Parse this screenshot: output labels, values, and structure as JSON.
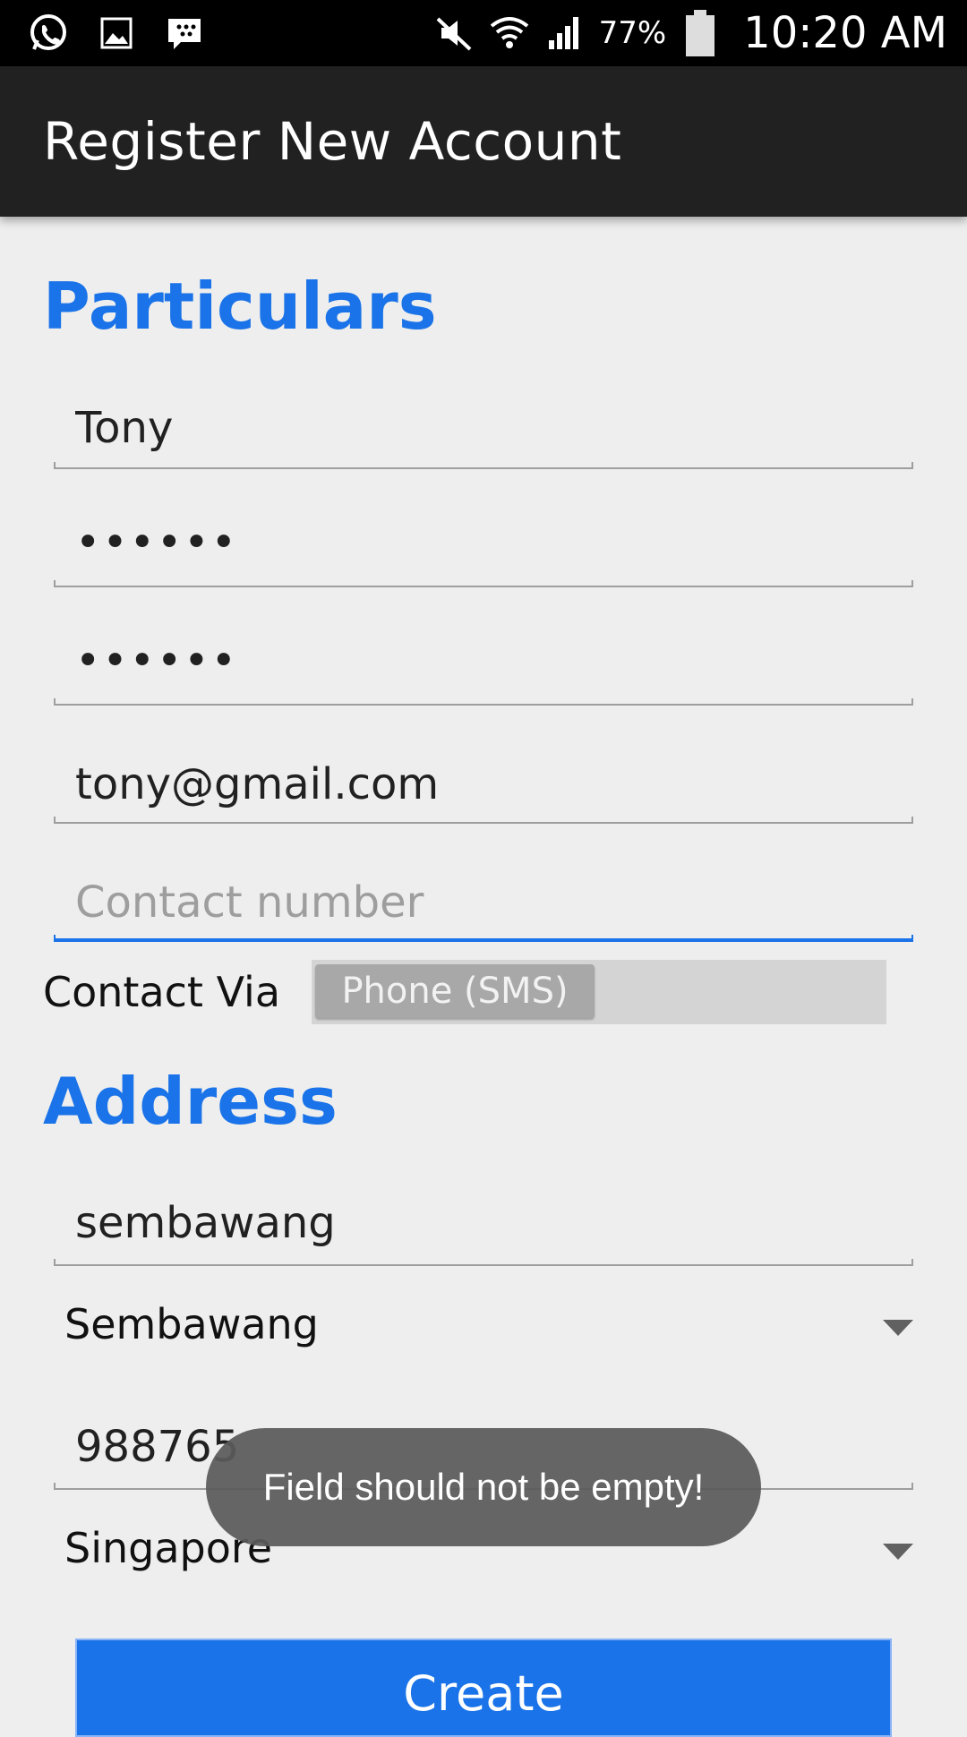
{
  "status_bar": {
    "left_icons": [
      "whatsapp-icon",
      "gallery-icon",
      "bbm-icon"
    ],
    "right_icons": [
      "mute-icon",
      "wifi-icon",
      "signal-icon",
      "battery-icon"
    ],
    "battery_percent": "77%",
    "time": "10:20 AM"
  },
  "app_bar": {
    "title": "Register New Account"
  },
  "particulars": {
    "heading": "Particulars",
    "name_value": "Tony",
    "password_value": "••••••",
    "confirm_password_value": "••••••",
    "email_value": "tony@gmail.com",
    "contact_number_placeholder": "Contact number",
    "contact_via_label": "Contact Via",
    "contact_via_option": "Phone (SMS)"
  },
  "address": {
    "heading": "Address",
    "street_value": "sembawang",
    "district_selected": "Sembawang",
    "postal_code_value": "988765",
    "country_selected": "Singapore"
  },
  "create_button_label": "Create",
  "toast_message": "Field should not be empty!",
  "colors": {
    "accent": "#1a73e8",
    "app_bar": "#212121",
    "background": "#eeeeee"
  }
}
